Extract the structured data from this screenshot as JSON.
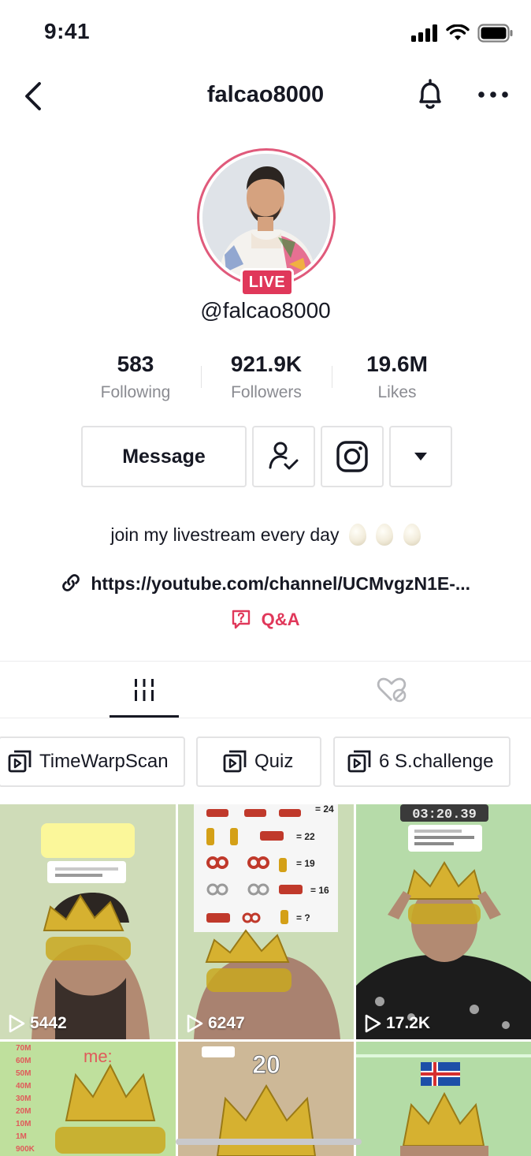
{
  "status": {
    "time": "9:41"
  },
  "nav": {
    "title": "falcao8000"
  },
  "profile": {
    "live_label": "LIVE",
    "handle": "@falcao8000",
    "stats": [
      {
        "value": "583",
        "label": "Following"
      },
      {
        "value": "921.9K",
        "label": "Followers"
      },
      {
        "value": "19.6M",
        "label": "Likes"
      }
    ],
    "message_label": "Message",
    "bio": "join my livestream every day",
    "link": "https://youtube.com/channel/UCMvgzN1E-...",
    "qa_label": "Q&A"
  },
  "playlists": [
    {
      "label": "TimeWarpScan"
    },
    {
      "label": "Quiz"
    },
    {
      "label": "6 S.challenge"
    }
  ],
  "videos": [
    {
      "views": "5442"
    },
    {
      "views": "6247"
    },
    {
      "views": "17.2K"
    },
    {
      "views": ""
    },
    {
      "views": ""
    },
    {
      "views": ""
    }
  ],
  "thumbs": {
    "t2_eq": [
      "= 24",
      "= 22",
      "= 19",
      "= 16",
      "= ?"
    ],
    "t3_timer": "03:20.39",
    "t4_scale": [
      "70M",
      "60M",
      "50M",
      "40M",
      "30M",
      "20M",
      "10M",
      "1M",
      "900K"
    ],
    "t4_me": "me:",
    "t5_count": "20"
  },
  "colors": {
    "accent": "#e0385a",
    "text": "#161823",
    "muted": "#8a8b91",
    "border": "#e3e3e4"
  }
}
